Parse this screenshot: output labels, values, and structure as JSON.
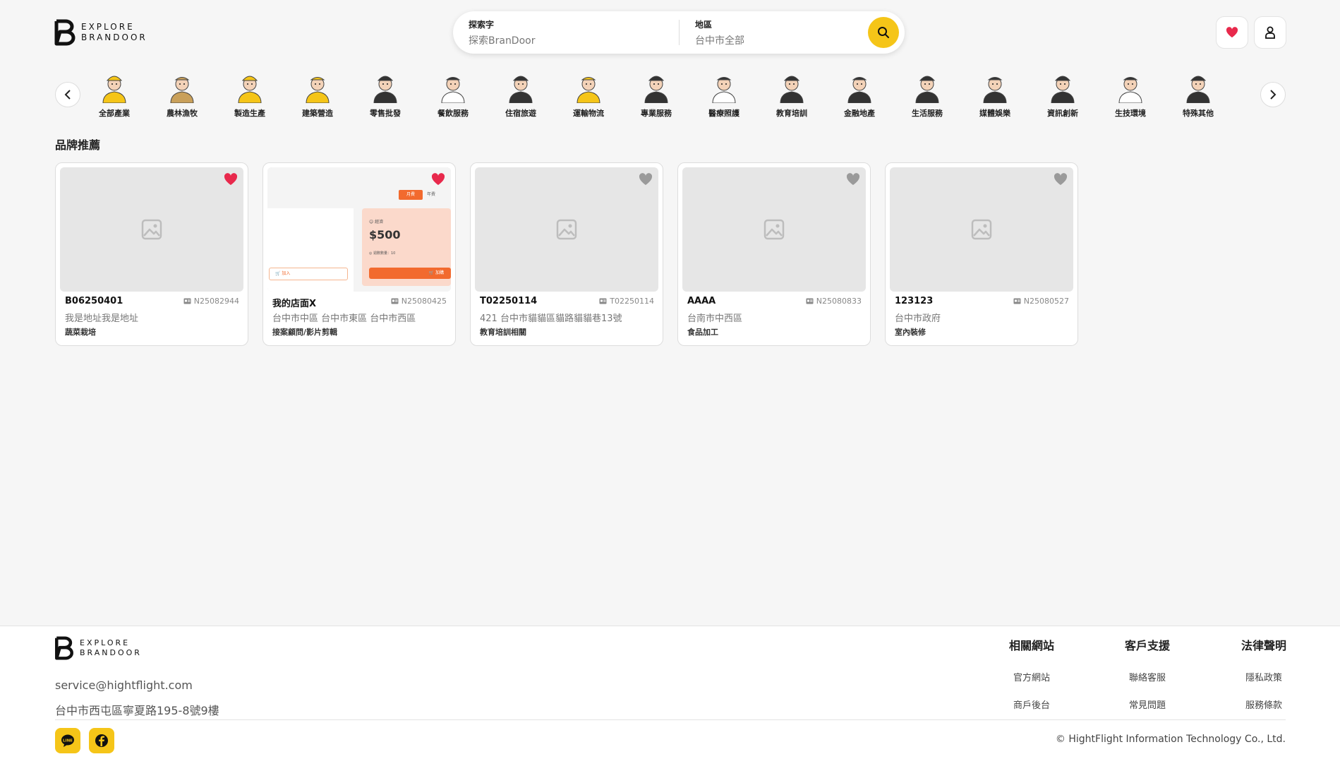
{
  "brand": {
    "logo_line1": "EXPLORE",
    "logo_line2": "BRANDOOR"
  },
  "search": {
    "keyword_label": "探索字",
    "keyword_value": "探索BranDoor",
    "region_label": "地區",
    "region_value": "台中市全部"
  },
  "categories": [
    {
      "label": "全部產業",
      "icon": "all-industries-avatar",
      "color": "#f5c518"
    },
    {
      "label": "農林漁牧",
      "icon": "farmer-avatar",
      "color": "#c9a05a"
    },
    {
      "label": "製造生產",
      "icon": "mechanic-avatar",
      "color": "#f5c518"
    },
    {
      "label": "建築營造",
      "icon": "builder-avatar",
      "color": "#f5c518"
    },
    {
      "label": "零售批發",
      "icon": "retailer-avatar",
      "color": "#333333"
    },
    {
      "label": "餐飲服務",
      "icon": "chef-avatar",
      "color": "#ffffff"
    },
    {
      "label": "住宿旅遊",
      "icon": "hotel-staff-avatar",
      "color": "#333333"
    },
    {
      "label": "運輸物流",
      "icon": "courier-avatar",
      "color": "#f5c518"
    },
    {
      "label": "專業服務",
      "icon": "professional-avatar",
      "color": "#333333"
    },
    {
      "label": "醫療照護",
      "icon": "doctor-avatar",
      "color": "#ffffff"
    },
    {
      "label": "教育培訓",
      "icon": "teacher-avatar",
      "color": "#333333"
    },
    {
      "label": "金融地產",
      "icon": "finance-avatar",
      "color": "#333333"
    },
    {
      "label": "生活服務",
      "icon": "life-service-avatar",
      "color": "#333333"
    },
    {
      "label": "媒體娛樂",
      "icon": "media-avatar",
      "color": "#333333"
    },
    {
      "label": "資訊創新",
      "icon": "it-avatar",
      "color": "#333333"
    },
    {
      "label": "生技環境",
      "icon": "biotech-avatar",
      "color": "#ffffff"
    },
    {
      "label": "特殊其他",
      "icon": "other-avatar",
      "color": "#333333"
    }
  ],
  "section_title": "品牌推薦",
  "cards": [
    {
      "name": "B06250401",
      "id": "N25082944",
      "address": "我是地址我是地址",
      "category": "蔬菜栽培",
      "favorited": true,
      "has_image": false
    },
    {
      "name": "我的店面X",
      "id": "N25080425",
      "address": "台中市中區 台中市東區 台中市西區",
      "category": "接案顧問/影片剪輯",
      "favorited": true,
      "has_image": true
    },
    {
      "name": "T02250114",
      "id": "T02250114",
      "address": "421 台中市貓貓區貓路貓貓巷13號",
      "category": "教育培訓相關",
      "favorited": false,
      "has_image": false
    },
    {
      "name": "AAAA",
      "id": "N25080833",
      "address": "台南市中西區",
      "category": "食品加工",
      "favorited": false,
      "has_image": false
    },
    {
      "name": "123123",
      "id": "N25080527",
      "address": "台中市政府",
      "category": "室內裝修",
      "favorited": false,
      "has_image": false
    }
  ],
  "mock_thumb": {
    "tab_active": "月費",
    "tab_other": "年費",
    "plan": "☺ 經濟",
    "price": "$500",
    "note": "◎ 週數數量：10",
    "buy_btn": "🛒 加購",
    "cart_btn": "🛒 加入"
  },
  "footer": {
    "email": "service@hightflight.com",
    "address": "台中市西屯區寧夏路195-8號9樓",
    "columns": [
      {
        "title": "相關網站",
        "links": [
          "官方網站",
          "商戶後台"
        ]
      },
      {
        "title": "客戶支援",
        "links": [
          "聯絡客服",
          "常見問題"
        ]
      },
      {
        "title": "法律聲明",
        "links": [
          "隱私政策",
          "服務條款"
        ]
      }
    ],
    "copyright": "© HightFlight Information Technology Co., Ltd."
  },
  "colors": {
    "accent": "#f5c518",
    "heart_active": "#e8294c",
    "heart_inactive": "#9a9a9a",
    "background": "#f6f6f6"
  }
}
